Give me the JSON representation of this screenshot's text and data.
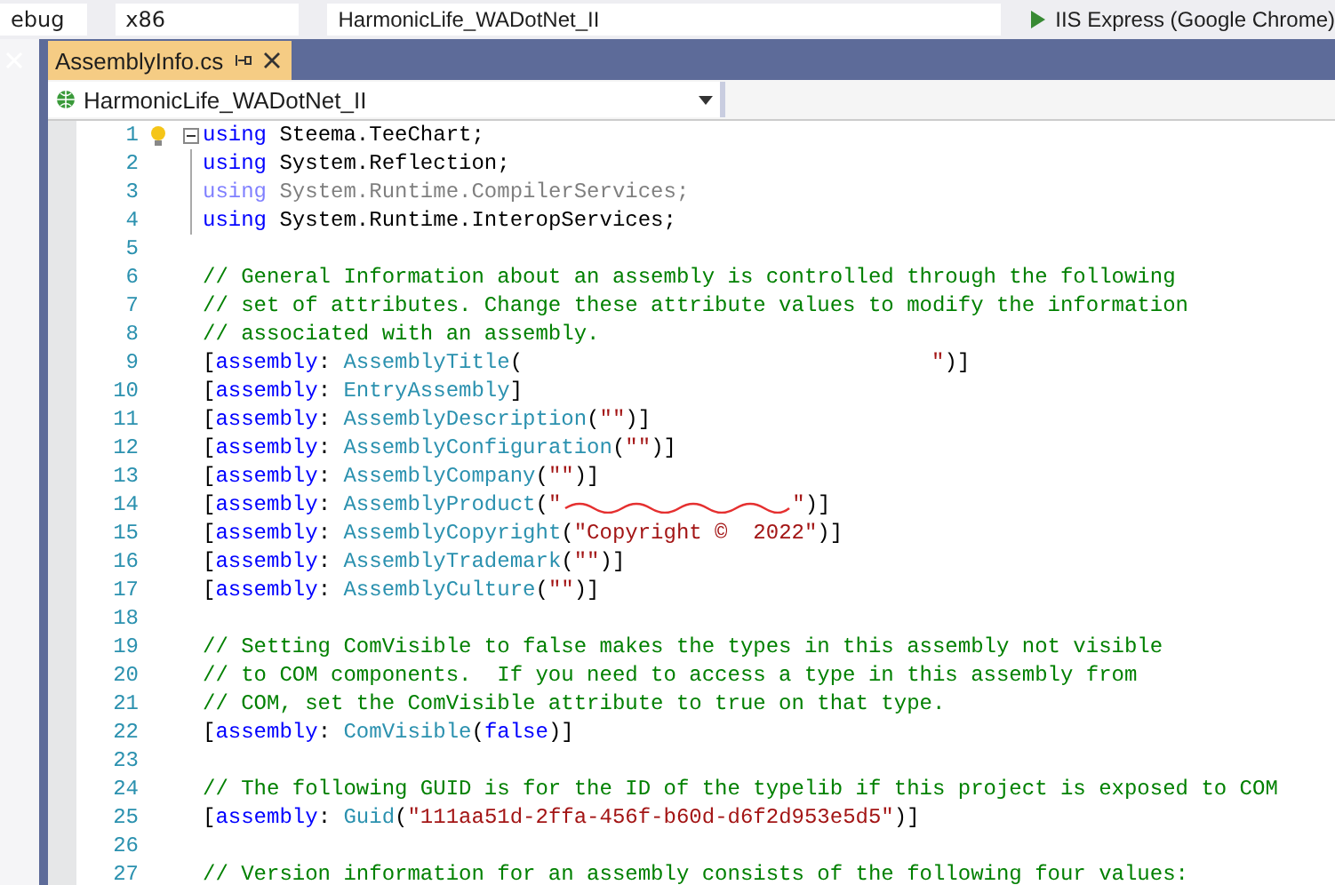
{
  "toolbar": {
    "fields": [
      {
        "kind": "combo",
        "value": "ebug"
      },
      {
        "kind": "combo",
        "value": "x86"
      },
      {
        "kind": "combo",
        "value": "HarmonicLife_WADotNet_II"
      }
    ],
    "run_button": {
      "label": "IIS Express (Google Chrome)"
    }
  },
  "tabs": [
    {
      "label": "AssemblyInfo.cs",
      "selected": true
    }
  ],
  "nav_bar": {
    "project": "HarmonicLife_WADotNet_II"
  },
  "editor": {
    "lines": [
      {
        "number": "1",
        "faded": false,
        "tokens": [
          {
            "kind": "kw",
            "text": "using"
          },
          {
            "kind": "plain",
            "text": " Steema.TeeChart;"
          }
        ]
      },
      {
        "number": "2",
        "faded": false,
        "tokens": [
          {
            "kind": "kw",
            "text": "using"
          },
          {
            "kind": "plain",
            "text": " System.Reflection;"
          }
        ]
      },
      {
        "number": "3",
        "faded": true,
        "tokens": [
          {
            "kind": "kw",
            "text": "using"
          },
          {
            "kind": "plain",
            "text": " System.Runtime.CompilerServices;"
          }
        ]
      },
      {
        "number": "4",
        "faded": false,
        "tokens": [
          {
            "kind": "kw",
            "text": "using"
          },
          {
            "kind": "plain",
            "text": " System.Runtime.InteropServices;"
          }
        ]
      },
      {
        "number": "5",
        "faded": false
      },
      {
        "number": "6",
        "faded": false,
        "tokens": [
          {
            "kind": "comment",
            "text": "// General Information about an assembly is controlled through the following"
          }
        ]
      },
      {
        "number": "7",
        "faded": false,
        "tokens": [
          {
            "kind": "comment",
            "text": "// set of attributes. Change these attribute values to modify the information"
          }
        ]
      },
      {
        "number": "8",
        "faded": false,
        "tokens": [
          {
            "kind": "comment",
            "text": "// associated with an assembly."
          }
        ]
      },
      {
        "number": "9",
        "faded": false,
        "tokens": [
          {
            "kind": "plain",
            "text": "["
          },
          {
            "kind": "kw",
            "text": "assembly"
          },
          {
            "kind": "plain",
            "text": ": "
          },
          {
            "kind": "type",
            "text": "AssemblyTitle"
          },
          {
            "kind": "plain",
            "text": "("
          },
          {
            "kind": "blank"
          },
          {
            "kind": "str",
            "text": "\""
          },
          {
            "kind": "plain",
            "text": ")]"
          }
        ]
      },
      {
        "number": "10",
        "faded": false,
        "tokens": [
          {
            "kind": "plain",
            "text": "["
          },
          {
            "kind": "kw",
            "text": "assembly"
          },
          {
            "kind": "plain",
            "text": ": "
          },
          {
            "kind": "type",
            "text": "EntryAssembly"
          },
          {
            "kind": "plain",
            "text": "]"
          }
        ]
      },
      {
        "number": "11",
        "faded": false,
        "tokens": [
          {
            "kind": "plain",
            "text": "["
          },
          {
            "kind": "kw",
            "text": "assembly"
          },
          {
            "kind": "plain",
            "text": ": "
          },
          {
            "kind": "type",
            "text": "AssemblyDescription"
          },
          {
            "kind": "plain",
            "text": "("
          },
          {
            "kind": "str",
            "text": "\"\""
          },
          {
            "kind": "plain",
            "text": ")]"
          }
        ]
      },
      {
        "number": "12",
        "faded": false,
        "tokens": [
          {
            "kind": "plain",
            "text": "["
          },
          {
            "kind": "kw",
            "text": "assembly"
          },
          {
            "kind": "plain",
            "text": ": "
          },
          {
            "kind": "type",
            "text": "AssemblyConfiguration"
          },
          {
            "kind": "plain",
            "text": "("
          },
          {
            "kind": "str",
            "text": "\"\""
          },
          {
            "kind": "plain",
            "text": ")]"
          }
        ]
      },
      {
        "number": "13",
        "faded": false,
        "tokens": [
          {
            "kind": "plain",
            "text": "["
          },
          {
            "kind": "kw",
            "text": "assembly"
          },
          {
            "kind": "plain",
            "text": ": "
          },
          {
            "kind": "type",
            "text": "AssemblyCompany"
          },
          {
            "kind": "plain",
            "text": "("
          },
          {
            "kind": "str",
            "text": "\"\""
          },
          {
            "kind": "plain",
            "text": ")]"
          }
        ]
      },
      {
        "number": "14",
        "faded": false,
        "tokens": [
          {
            "kind": "plain",
            "text": "["
          },
          {
            "kind": "kw",
            "text": "assembly"
          },
          {
            "kind": "plain",
            "text": ": "
          },
          {
            "kind": "type",
            "text": "AssemblyProduct"
          },
          {
            "kind": "plain",
            "text": "("
          },
          {
            "kind": "str",
            "text": "\""
          },
          {
            "kind": "redacted"
          },
          {
            "kind": "str",
            "text": "\""
          },
          {
            "kind": "plain",
            "text": ")]"
          }
        ]
      },
      {
        "number": "15",
        "faded": false,
        "tokens": [
          {
            "kind": "plain",
            "text": "["
          },
          {
            "kind": "kw",
            "text": "assembly"
          },
          {
            "kind": "plain",
            "text": ": "
          },
          {
            "kind": "type",
            "text": "AssemblyCopyright"
          },
          {
            "kind": "plain",
            "text": "("
          },
          {
            "kind": "str",
            "text": "\"Copyright ©  2022\""
          },
          {
            "kind": "plain",
            "text": ")]"
          }
        ]
      },
      {
        "number": "16",
        "faded": false,
        "tokens": [
          {
            "kind": "plain",
            "text": "["
          },
          {
            "kind": "kw",
            "text": "assembly"
          },
          {
            "kind": "plain",
            "text": ": "
          },
          {
            "kind": "type",
            "text": "AssemblyTrademark"
          },
          {
            "kind": "plain",
            "text": "("
          },
          {
            "kind": "str",
            "text": "\"\""
          },
          {
            "kind": "plain",
            "text": ")]"
          }
        ]
      },
      {
        "number": "17",
        "faded": false,
        "tokens": [
          {
            "kind": "plain",
            "text": "["
          },
          {
            "kind": "kw",
            "text": "assembly"
          },
          {
            "kind": "plain",
            "text": ": "
          },
          {
            "kind": "type",
            "text": "AssemblyCulture"
          },
          {
            "kind": "plain",
            "text": "("
          },
          {
            "kind": "str",
            "text": "\"\""
          },
          {
            "kind": "plain",
            "text": ")]"
          }
        ]
      },
      {
        "number": "18",
        "faded": false
      },
      {
        "number": "19",
        "faded": false,
        "tokens": [
          {
            "kind": "comment",
            "text": "// Setting ComVisible to false makes the types in this assembly not visible"
          }
        ]
      },
      {
        "number": "20",
        "faded": false,
        "tokens": [
          {
            "kind": "comment",
            "text": "// to COM components.  If you need to access a type in this assembly from"
          }
        ]
      },
      {
        "number": "21",
        "faded": false,
        "tokens": [
          {
            "kind": "comment",
            "text": "// COM, set the ComVisible attribute to true on that type."
          }
        ]
      },
      {
        "number": "22",
        "faded": false,
        "tokens": [
          {
            "kind": "plain",
            "text": "["
          },
          {
            "kind": "kw",
            "text": "assembly"
          },
          {
            "kind": "plain",
            "text": ": "
          },
          {
            "kind": "type",
            "text": "ComVisible"
          },
          {
            "kind": "plain",
            "text": "("
          },
          {
            "kind": "kw",
            "text": "false"
          },
          {
            "kind": "plain",
            "text": ")]"
          }
        ]
      },
      {
        "number": "23",
        "faded": false
      },
      {
        "number": "24",
        "faded": false,
        "tokens": [
          {
            "kind": "comment",
            "text": "// The following GUID is for the ID of the typelib if this project is exposed to COM"
          }
        ]
      },
      {
        "number": "25",
        "faded": false,
        "tokens": [
          {
            "kind": "plain",
            "text": "["
          },
          {
            "kind": "kw",
            "text": "assembly"
          },
          {
            "kind": "plain",
            "text": ": "
          },
          {
            "kind": "type",
            "text": "Guid"
          },
          {
            "kind": "plain",
            "text": "("
          },
          {
            "kind": "str",
            "text": "\"111aa51d-2ffa-456f-b60d-d6f2d953e5d5\""
          },
          {
            "kind": "plain",
            "text": ")]"
          }
        ]
      },
      {
        "number": "26",
        "faded": false
      },
      {
        "number": "27",
        "faded": false,
        "tokens": [
          {
            "kind": "comment",
            "text": "// Version information for an assembly consists of the following four values:"
          }
        ]
      }
    ]
  }
}
